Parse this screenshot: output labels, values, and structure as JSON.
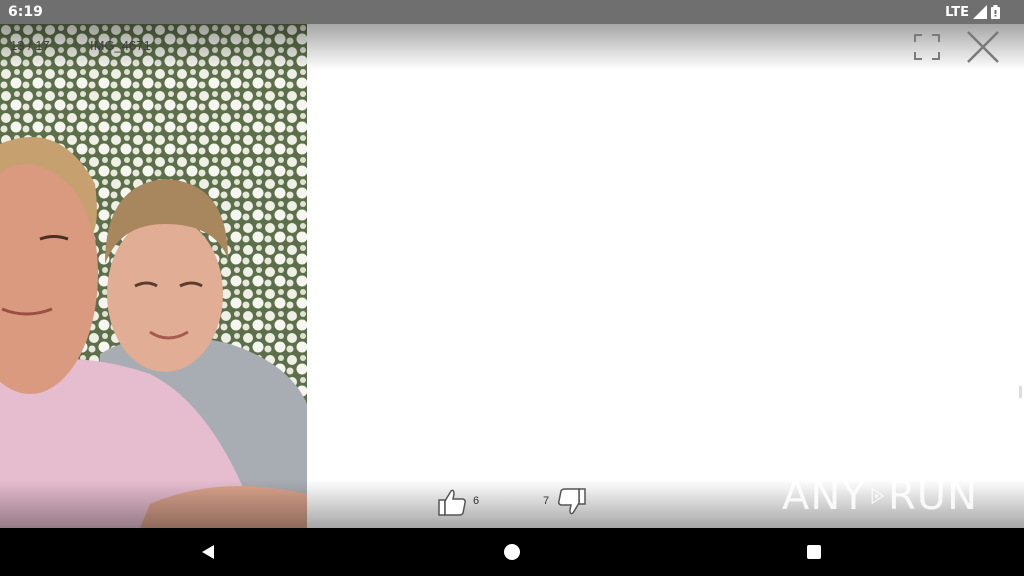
{
  "status_bar": {
    "time": "6:19",
    "network": "LTE",
    "icons": [
      "signal-icon",
      "battery-icon"
    ]
  },
  "viewer": {
    "counter": "13 / 17",
    "filename": "IMG_4671",
    "photo_description_icon": "photo-image",
    "controls": {
      "fullscreen_icon": "fullscreen-icon",
      "close_icon": "close-icon"
    },
    "rating": {
      "likes": "6",
      "dislikes": "7",
      "like_icon": "thumbs-up-icon",
      "dislike_icon": "thumbs-down-icon"
    },
    "watermark": {
      "left": "ANY",
      "right": "RUN"
    }
  },
  "nav_bar": {
    "icons": [
      "back-icon",
      "home-icon",
      "recents-icon"
    ]
  },
  "colors": {
    "status_bar": "#6f6f6f",
    "viewer_bg": "#ffffff",
    "nav_bar": "#000000"
  }
}
